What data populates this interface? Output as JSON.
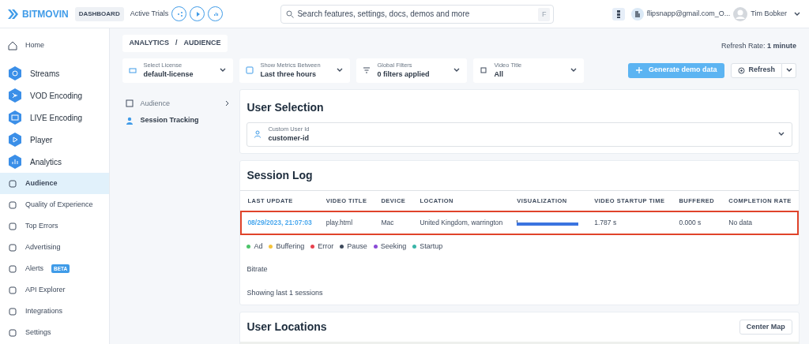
{
  "header": {
    "logo": "BITMOVIN",
    "badge": "DASHBOARD",
    "trials_label": "Active Trials",
    "search_placeholder": "Search features, settings, docs, demos and more",
    "search_shortcut": "F",
    "account": "flipsnapp@gmail.com_O...",
    "user": "Tim Bobker"
  },
  "sidebar": {
    "items": [
      {
        "label": "Home",
        "kind": "plain",
        "selected": false
      },
      {
        "label": "Streams",
        "kind": "product",
        "selected": false
      },
      {
        "label": "VOD Encoding",
        "kind": "product",
        "selected": false
      },
      {
        "label": "LIVE Encoding",
        "kind": "product",
        "selected": false
      },
      {
        "label": "Player",
        "kind": "product",
        "selected": false
      },
      {
        "label": "Analytics",
        "kind": "product",
        "selected": false
      },
      {
        "label": "Audience",
        "kind": "sub",
        "selected": true
      },
      {
        "label": "Quality of Experience",
        "kind": "sub",
        "selected": false
      },
      {
        "label": "Top Errors",
        "kind": "sub",
        "selected": false
      },
      {
        "label": "Advertising",
        "kind": "sub",
        "selected": false
      },
      {
        "label": "Alerts",
        "kind": "sub",
        "selected": false,
        "badge": "BETA"
      },
      {
        "label": "API Explorer",
        "kind": "sub",
        "selected": false
      },
      {
        "label": "Integrations",
        "kind": "sub",
        "selected": false
      },
      {
        "label": "Settings",
        "kind": "sub",
        "selected": false
      }
    ]
  },
  "breadcrumb": {
    "items": [
      "ANALYTICS",
      "AUDIENCE"
    ],
    "separator": "/"
  },
  "refresh_rate": {
    "label": "Refresh Rate:",
    "value": "1 minute"
  },
  "filters": [
    {
      "label": "Select License",
      "value": "default-license"
    },
    {
      "label": "Show Metrics Between",
      "value": "Last three hours"
    },
    {
      "label": "Global Filters",
      "value": "0 filters applied"
    },
    {
      "label": "Video Title",
      "value": "All"
    }
  ],
  "actions": {
    "generate": "Generate demo data",
    "refresh": "Refresh"
  },
  "subnav": [
    {
      "label": "Audience",
      "selected": false,
      "has_arrow": true
    },
    {
      "label": "Session Tracking",
      "selected": true,
      "has_arrow": false
    }
  ],
  "user_selection": {
    "title": "User Selection",
    "field_label": "Custom User Id",
    "field_value": "customer-id"
  },
  "session_log": {
    "title": "Session Log",
    "columns": [
      "LAST UPDATE",
      "VIDEO TITLE",
      "DEVICE",
      "LOCATION",
      "VISUALIZATION",
      "VIDEO STARTUP TIME",
      "BUFFERED",
      "COMPLETION RATE"
    ],
    "rows": [
      {
        "last_update": "08/29/2023, 21:07:03",
        "video_title": "play.html",
        "device": "Mac",
        "location": "United Kingdom, warrington",
        "startup": "1.787 s",
        "buffered": "0.000 s",
        "completion": "No data",
        "highlighted": true
      }
    ],
    "legend": [
      {
        "label": "Ad",
        "color": "#4cc46a"
      },
      {
        "label": "Buffering",
        "color": "#f5c33b"
      },
      {
        "label": "Error",
        "color": "#e8424f"
      },
      {
        "label": "Pause",
        "color": "#3e4a5c"
      },
      {
        "label": "Seeking",
        "color": "#8a4bd6"
      },
      {
        "label": "Startup",
        "color": "#3ab5a8"
      }
    ],
    "bitrate_label": "Bitrate",
    "footer": "Showing last 1 sessions"
  },
  "user_locations": {
    "title": "User Locations",
    "button": "Center Map"
  }
}
